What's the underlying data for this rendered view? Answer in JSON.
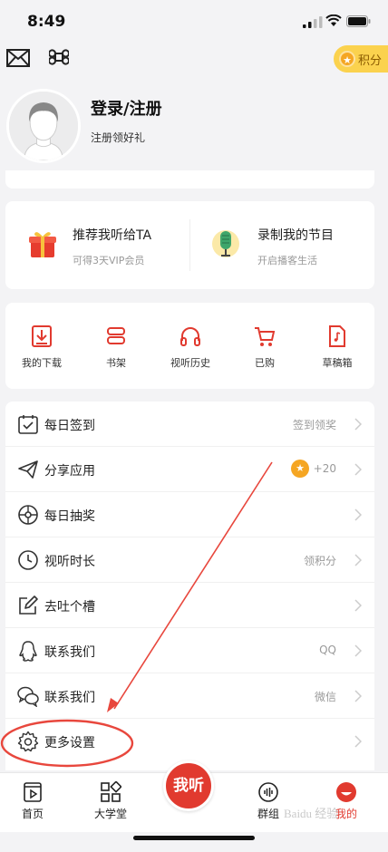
{
  "status": {
    "time": "8:49"
  },
  "topbar": {
    "points_label": "积分"
  },
  "profile": {
    "title": "登录/注册",
    "subtitle": "注册领好礼"
  },
  "promo": [
    {
      "title": "推荐我听给TA",
      "sub": "可得3天VIP会员"
    },
    {
      "title": "录制我的节目",
      "sub": "开启播客生活"
    }
  ],
  "quick": [
    {
      "label": "我的下载"
    },
    {
      "label": "书架"
    },
    {
      "label": "视听历史"
    },
    {
      "label": "已购"
    },
    {
      "label": "草稿箱"
    }
  ],
  "list": [
    {
      "label": "每日签到",
      "value": "签到领奖"
    },
    {
      "label": "分享应用",
      "value": "+20"
    },
    {
      "label": "每日抽奖",
      "value": ""
    },
    {
      "label": "视听时长",
      "value": "领积分"
    },
    {
      "label": "去吐个槽",
      "value": ""
    },
    {
      "label": "联系我们",
      "value": "QQ"
    },
    {
      "label": "联系我们",
      "value": "微信"
    },
    {
      "label": "更多设置",
      "value": ""
    }
  ],
  "tabs": {
    "home": "首页",
    "college": "大学堂",
    "center": "我听",
    "group": "群组",
    "mine": "我的"
  },
  "watermark": "Baidu 经验",
  "colors": {
    "accent": "#e13a2f",
    "gold": "#f5a623",
    "badge": "#fbd24e"
  }
}
